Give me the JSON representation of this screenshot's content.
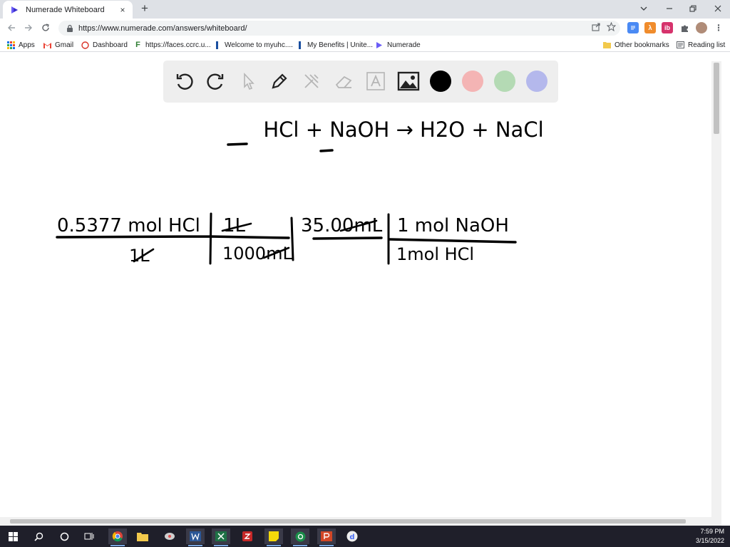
{
  "browser": {
    "tab_title": "Numerade Whiteboard",
    "tab_close": "×",
    "new_tab": "+",
    "url": "https://www.numerade.com/answers/whiteboard/"
  },
  "bookmarks": {
    "items": [
      {
        "label": "Apps",
        "icon": "apps-grid-icon"
      },
      {
        "label": "Gmail",
        "icon": "gmail-icon"
      },
      {
        "label": "Dashboard",
        "icon": "dashboard-icon"
      },
      {
        "label": "https://faces.ccrc.u...",
        "icon": "faces-icon"
      },
      {
        "label": "Welcome to myuhc....",
        "icon": "myuhc-icon"
      },
      {
        "label": "My Benefits | Unite...",
        "icon": "benefits-icon"
      },
      {
        "label": "Numerade",
        "icon": "numerade-icon"
      }
    ],
    "other": "Other bookmarks",
    "reading_list": "Reading list"
  },
  "whiteboard": {
    "tools": [
      "undo-icon",
      "redo-icon",
      "pointer-icon",
      "pen-icon",
      "tools-icon",
      "eraser-icon",
      "text-icon",
      "image-icon"
    ],
    "colors": [
      "#000000",
      "#f4b4b4",
      "#b4dab4",
      "#b4b8ec"
    ],
    "equation": "HCl + NaOH → H2O + NaCl",
    "conversion": {
      "numerators": [
        "0.5377 mol HCl",
        "1L",
        "35.00mL",
        "1 mol NaOH"
      ],
      "denominators": [
        "1L",
        "1000mL",
        "",
        "1mol HCl"
      ]
    }
  },
  "taskbar": {
    "time": "7:59 PM",
    "date": "3/15/2022"
  }
}
